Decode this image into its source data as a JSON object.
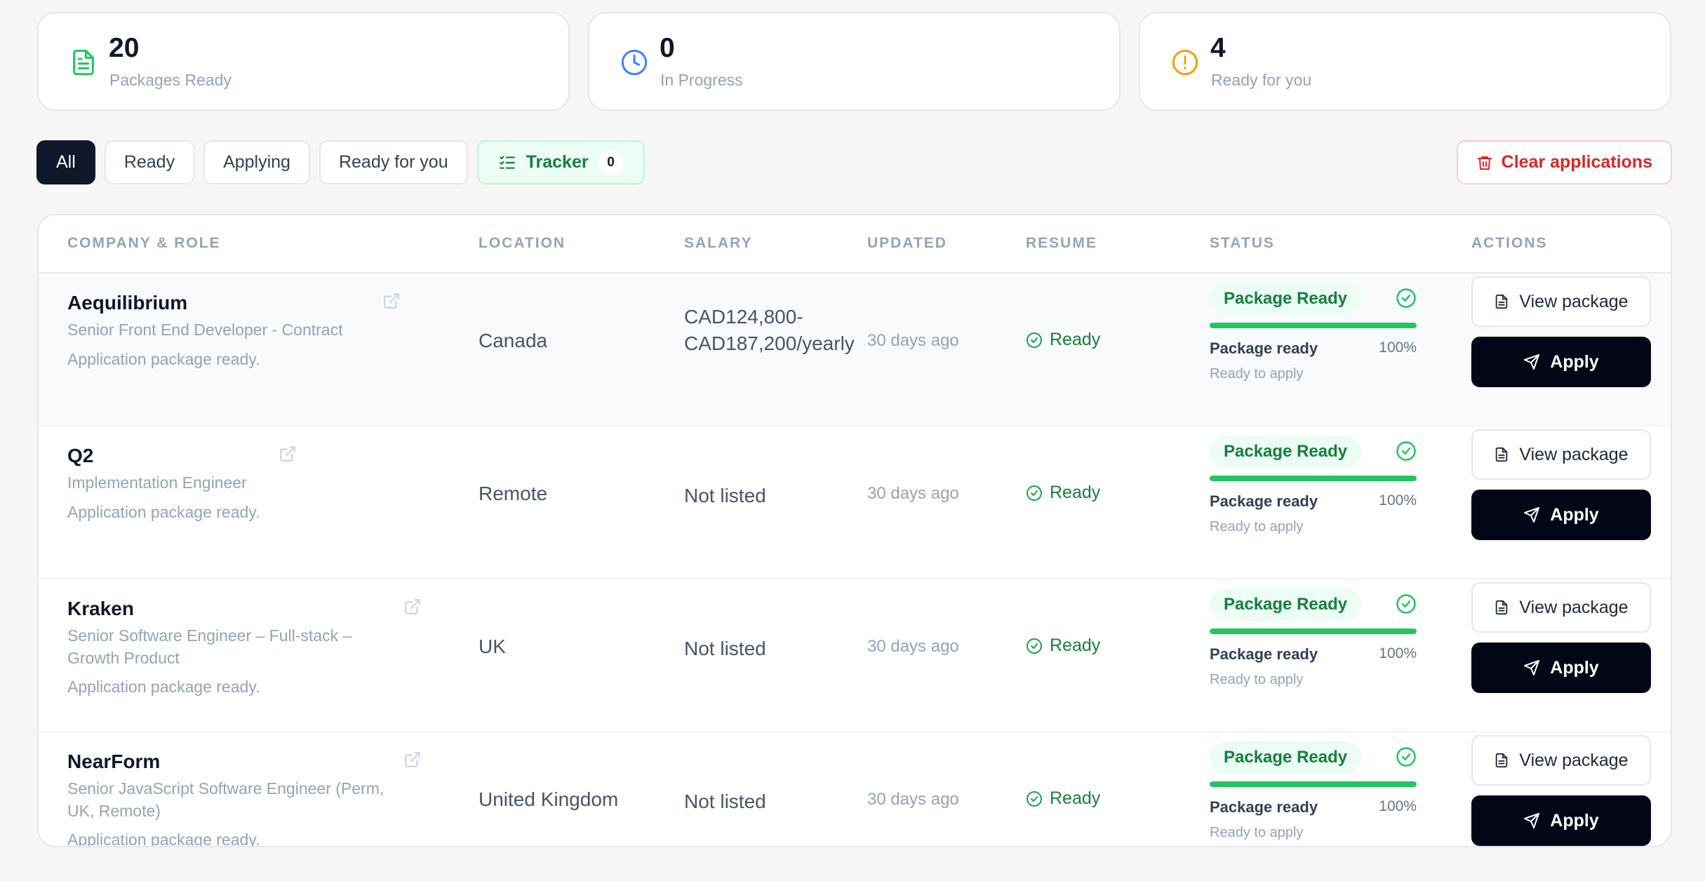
{
  "stats": [
    {
      "value": "20",
      "label": "Packages Ready",
      "icon": "document-icon",
      "color": "#22c55e"
    },
    {
      "value": "0",
      "label": "In Progress",
      "icon": "clock-icon",
      "color": "#3b82f6"
    },
    {
      "value": "4",
      "label": "Ready for you",
      "icon": "alert-circle-icon",
      "color": "#f59e0b"
    }
  ],
  "filters": {
    "all": "All",
    "ready": "Ready",
    "applying": "Applying",
    "ready_for_you": "Ready for you",
    "tracker": "Tracker",
    "tracker_count": "0",
    "clear": "Clear applications"
  },
  "table": {
    "headers": [
      "COMPANY & ROLE",
      "LOCATION",
      "SALARY",
      "UPDATED",
      "RESUME",
      "STATUS",
      "ACTIONS"
    ],
    "rows": [
      {
        "company": "Aequilibrium",
        "role": "Senior Front End Developer - Contract",
        "note": "Application package ready.",
        "location": "Canada",
        "salary": "CAD124,800-CAD187,200/yearly",
        "updated": "30 days ago",
        "resume": "Ready",
        "status_badge": "Package Ready",
        "progress_label": "Package ready",
        "progress_pct": "100%",
        "progress": 1.0,
        "sub_status": "Ready to apply",
        "view_label": "View package",
        "apply_label": "Apply"
      },
      {
        "company": "Q2",
        "role": "Implementation Engineer",
        "note": "Application package ready.",
        "location": "Remote",
        "salary": "Not listed",
        "updated": "30 days ago",
        "resume": "Ready",
        "status_badge": "Package Ready",
        "progress_label": "Package ready",
        "progress_pct": "100%",
        "progress": 1.0,
        "sub_status": "Ready to apply",
        "view_label": "View package",
        "apply_label": "Apply"
      },
      {
        "company": "Kraken",
        "role": "Senior Software Engineer – Full-stack – Growth Product",
        "note": "Application package ready.",
        "location": "UK",
        "salary": "Not listed",
        "updated": "30 days ago",
        "resume": "Ready",
        "status_badge": "Package Ready",
        "progress_label": "Package ready",
        "progress_pct": "100%",
        "progress": 1.0,
        "sub_status": "Ready to apply",
        "view_label": "View package",
        "apply_label": "Apply"
      },
      {
        "company": "NearForm",
        "role": "Senior JavaScript Software Engineer (Perm, UK, Remote)",
        "note": "Application package ready.",
        "location": "United Kingdom",
        "salary": "Not listed",
        "updated": "30 days ago",
        "resume": "Ready",
        "status_badge": "Package Ready",
        "progress_label": "Package ready",
        "progress_pct": "100%",
        "progress": 1.0,
        "sub_status": "Ready to apply",
        "view_label": "View package",
        "apply_label": "Apply"
      }
    ]
  }
}
